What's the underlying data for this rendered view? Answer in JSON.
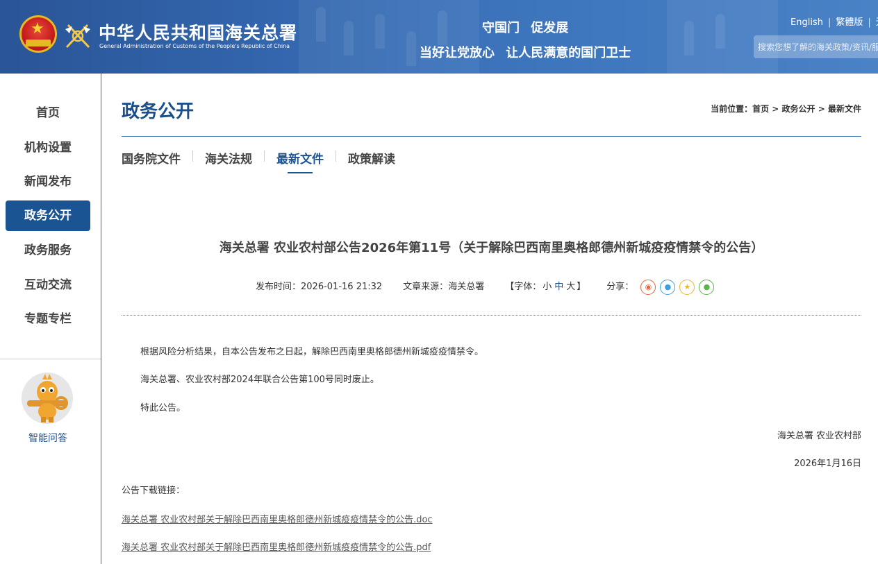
{
  "header": {
    "brand_cn": "中华人民共和国海关总署",
    "brand_en": "General Administration of Customs of the People's Republic of China",
    "slogan_line1": "守国门 促发展",
    "slogan_line2": "当好让党放心 让人民满意的国门卫士",
    "lang_links": [
      "English",
      "繁體版",
      "无"
    ],
    "search_placeholder": "搜索您想了解的海关政策/资讯/服务"
  },
  "sidebar": {
    "items": [
      {
        "label": "首页",
        "active": false
      },
      {
        "label": "机构设置",
        "active": false
      },
      {
        "label": "新闻发布",
        "active": false
      },
      {
        "label": "政务公开",
        "active": true
      },
      {
        "label": "政务服务",
        "active": false
      },
      {
        "label": "互动交流",
        "active": false
      },
      {
        "label": "专题专栏",
        "active": false
      }
    ],
    "assistant_label": "智能问答"
  },
  "main": {
    "section_title": "政务公开",
    "breadcrumb": {
      "prefix": "当前位置：",
      "items": [
        "首页",
        "政务公开",
        "最新文件"
      ],
      "sep": " > "
    },
    "tabs": [
      {
        "label": "国务院文件",
        "active": false
      },
      {
        "label": "海关法规",
        "active": false
      },
      {
        "label": "最新文件",
        "active": true
      },
      {
        "label": "政策解读",
        "active": false
      }
    ],
    "article": {
      "title": "海关总署 农业农村部公告2026年第11号（关于解除巴西南里奥格郎德州新城疫疫情禁令的公告）",
      "publish_label": "发布时间：",
      "publish_time": "2026-01-16 21:32",
      "source_label": "文章来源：",
      "source": "海关总署",
      "font_open": "【字体：",
      "font_small": "小",
      "font_mid": "中",
      "font_large": "大",
      "font_close": "】",
      "share_label": "分享：",
      "paragraphs": [
        "根据风险分析结果，自本公告发布之日起，解除巴西南里奥格郎德州新城疫疫情禁令。",
        "海关总署、农业农村部2024年联合公告第100号同时废止。",
        "特此公告。"
      ],
      "signature": "海关总署 农业农村部",
      "date": "2026年1月16日",
      "download_label": "公告下载链接：",
      "downloads": [
        "海关总署 农业农村部关于解除巴西南里奥格郎德州新城疫疫情禁令的公告.doc",
        "海关总署 农业农村部关于解除巴西南里奥格郎德州新城疫疫情禁令的公告.pdf"
      ]
    }
  },
  "colors": {
    "header_blue": "#2a5597",
    "nav_active": "#1b5493",
    "title_blue": "#1b4f8c",
    "share_weibo": "#e8643c",
    "share_qq": "#3ca0e0",
    "share_qzone": "#f0b429",
    "share_wechat": "#5bb54a"
  },
  "icons": [
    "national-emblem-icon",
    "customs-logo-icon",
    "weibo-icon",
    "qq-icon",
    "qzone-icon",
    "wechat-icon",
    "mascot-icon"
  ]
}
